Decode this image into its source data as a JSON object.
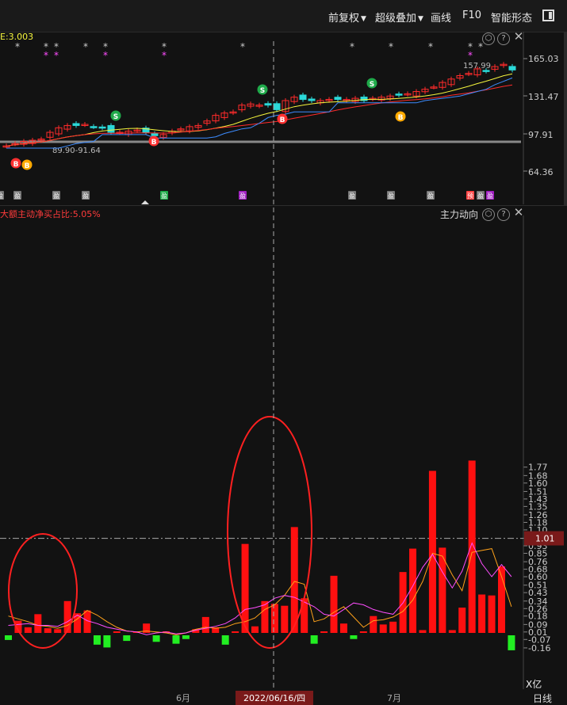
{
  "toolbar": {
    "fuquan": "前复权",
    "chaoji": "超级叠加",
    "huaxian": "画线",
    "f10": "F10",
    "zhineng": "智能形态"
  },
  "kline": {
    "indicator_text": "E:3.003",
    "price_ticks": [
      "165.03",
      "131.47",
      "97.91",
      "64.36"
    ],
    "high_label": "157.99",
    "low_label": "89.90-91.64",
    "buy_label": "B",
    "sell_label": "S",
    "event_tags": [
      "盈",
      "中",
      "预"
    ],
    "colors": {
      "up": "#ff2b2b",
      "down": "#2bd92b",
      "ma_yellow": "#f5f53d",
      "ma_blue": "#3d8cff"
    }
  },
  "flow": {
    "title": "大额主动净买占比:5.05%",
    "panel_name": "主力动向",
    "unit": "X亿",
    "highlight_value": "1.01",
    "y_ticks": [
      "1.77",
      "1.68",
      "1.60",
      "1.51",
      "1.43",
      "1.35",
      "1.26",
      "1.18",
      "1.10",
      "1.01",
      "0.93",
      "0.85",
      "0.76",
      "0.68",
      "0.60",
      "0.51",
      "0.43",
      "0.34",
      "0.26",
      "0.18",
      "0.09",
      "0.01",
      "-0.07",
      "-0.16"
    ]
  },
  "x_axis": {
    "month_6": "6月",
    "month_7": "7月",
    "cursor_date": "2022/06/16/四",
    "period": "日线"
  },
  "chart_data": {
    "type": "bar",
    "title": "大额主动净买占比:5.05%",
    "ylim": [
      -0.21,
      1.86
    ],
    "values": [
      -0.05,
      0.13,
      0.06,
      0.2,
      0.05,
      0.04,
      0.34,
      0.21,
      0.24,
      -0.1,
      -0.13,
      0.0,
      -0.06,
      0.0,
      0.1,
      -0.07,
      0.0,
      -0.09,
      -0.04,
      0.04,
      0.17,
      0.06,
      -0.1,
      0.0,
      0.95,
      0.07,
      0.34,
      0.31,
      0.29,
      1.13,
      0.37,
      -0.09,
      0.0,
      0.61,
      0.1,
      -0.04,
      0.0,
      0.18,
      0.09,
      0.12,
      0.65,
      0.9,
      0.03,
      1.73,
      0.91,
      0.03,
      0.27,
      1.84,
      0.41,
      0.4,
      0.71,
      -0.16
    ],
    "series": [
      {
        "color": "#ffa21a",
        "values": [
          0.18,
          0.15,
          0.12,
          0.08,
          0.07,
          0.05,
          0.08,
          0.15,
          0.24,
          0.19,
          0.12,
          0.06,
          0.02,
          0.01,
          0.02,
          0.01,
          0.0,
          -0.02,
          0.0,
          0.04,
          0.06,
          0.05,
          0.06,
          0.1,
          0.12,
          0.16,
          0.25,
          0.3,
          0.4,
          0.55,
          0.52,
          0.12,
          0.15,
          0.22,
          0.28,
          0.17,
          0.06,
          0.13,
          0.14,
          0.17,
          0.23,
          0.35,
          0.55,
          0.85,
          0.82,
          0.62,
          0.45,
          0.86,
          0.88,
          0.9,
          0.6,
          0.28
        ]
      },
      {
        "color": "#ff4dff",
        "values": [
          0.08,
          0.09,
          0.1,
          0.08,
          0.08,
          0.07,
          0.12,
          0.19,
          0.13,
          0.1,
          0.06,
          0.04,
          0.02,
          0.01,
          -0.02,
          0.0,
          0.01,
          -0.01,
          0.0,
          0.03,
          0.05,
          0.07,
          0.1,
          0.16,
          0.25,
          0.27,
          0.3,
          0.37,
          0.4,
          0.38,
          0.33,
          0.28,
          0.2,
          0.18,
          0.25,
          0.32,
          0.3,
          0.25,
          0.22,
          0.2,
          0.32,
          0.5,
          0.7,
          0.84,
          0.65,
          0.48,
          0.66,
          0.96,
          0.74,
          0.6,
          0.73,
          0.6
        ]
      }
    ]
  }
}
